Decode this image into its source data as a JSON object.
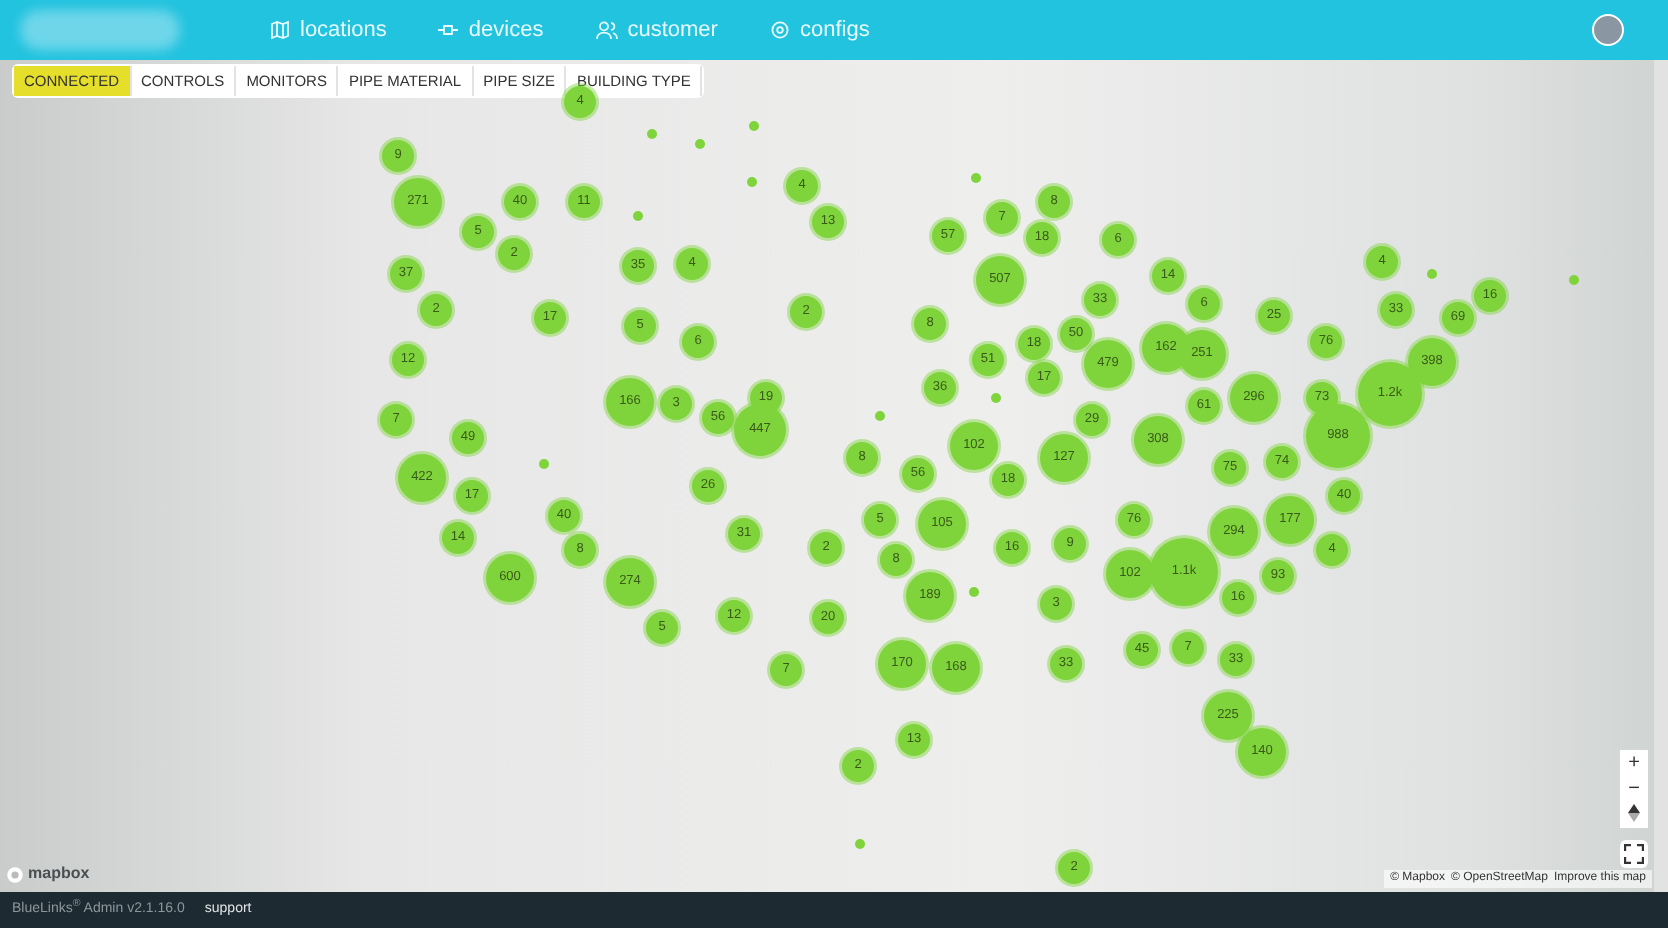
{
  "navbar": {
    "items": [
      {
        "label": "locations"
      },
      {
        "label": "devices"
      },
      {
        "label": "customer"
      },
      {
        "label": "configs"
      }
    ]
  },
  "filter_tabs": [
    {
      "label": "CONNECTED",
      "selected": true
    },
    {
      "label": "CONTROLS",
      "selected": false
    },
    {
      "label": "MONITORS",
      "selected": false
    },
    {
      "label": "PIPE MATERIAL",
      "selected": false
    },
    {
      "label": "PIPE SIZE",
      "selected": false
    },
    {
      "label": "BUILDING TYPE",
      "selected": false
    }
  ],
  "map": {
    "clusters": [
      {
        "count": "4"
      },
      {
        "count": "9"
      },
      {
        "count": "4"
      },
      {
        "count": "271"
      },
      {
        "count": "40"
      },
      {
        "count": "11"
      },
      {
        "count": "7"
      },
      {
        "count": "8"
      },
      {
        "count": "5"
      },
      {
        "count": "13"
      },
      {
        "count": "57"
      },
      {
        "count": "18"
      },
      {
        "count": "2"
      },
      {
        "count": "6"
      },
      {
        "count": "37"
      },
      {
        "count": "35"
      },
      {
        "count": "4"
      },
      {
        "count": "14"
      },
      {
        "count": "4"
      },
      {
        "count": "507"
      },
      {
        "count": "16"
      },
      {
        "count": "2"
      },
      {
        "count": "17"
      },
      {
        "count": "2"
      },
      {
        "count": "33"
      },
      {
        "count": "6"
      },
      {
        "count": "25"
      },
      {
        "count": "33"
      },
      {
        "count": "69"
      },
      {
        "count": "5"
      },
      {
        "count": "8"
      },
      {
        "count": "50"
      },
      {
        "count": "6"
      },
      {
        "count": "18"
      },
      {
        "count": "162"
      },
      {
        "count": "251"
      },
      {
        "count": "76"
      },
      {
        "count": "12"
      },
      {
        "count": "51"
      },
      {
        "count": "17"
      },
      {
        "count": "479"
      },
      {
        "count": "398"
      },
      {
        "count": "19"
      },
      {
        "count": "36"
      },
      {
        "count": "296"
      },
      {
        "count": "73"
      },
      {
        "count": "1.2k"
      },
      {
        "count": "166"
      },
      {
        "count": "3"
      },
      {
        "count": "56"
      },
      {
        "count": "61"
      },
      {
        "count": "7"
      },
      {
        "count": "49"
      },
      {
        "count": "447"
      },
      {
        "count": "29"
      },
      {
        "count": "988"
      },
      {
        "count": "8"
      },
      {
        "count": "102"
      },
      {
        "count": "127"
      },
      {
        "count": "308"
      },
      {
        "count": "422"
      },
      {
        "count": "56"
      },
      {
        "count": "75"
      },
      {
        "count": "74"
      },
      {
        "count": "17"
      },
      {
        "count": "26"
      },
      {
        "count": "18"
      },
      {
        "count": "40"
      },
      {
        "count": "40"
      },
      {
        "count": "14"
      },
      {
        "count": "31"
      },
      {
        "count": "5"
      },
      {
        "count": "105"
      },
      {
        "count": "76"
      },
      {
        "count": "294"
      },
      {
        "count": "177"
      },
      {
        "count": "8"
      },
      {
        "count": "2"
      },
      {
        "count": "16"
      },
      {
        "count": "9"
      },
      {
        "count": "4"
      },
      {
        "count": "600"
      },
      {
        "count": "8"
      },
      {
        "count": "102"
      },
      {
        "count": "1.1k"
      },
      {
        "count": "93"
      },
      {
        "count": "274"
      },
      {
        "count": "189"
      },
      {
        "count": "16"
      },
      {
        "count": "12"
      },
      {
        "count": "20"
      },
      {
        "count": "3"
      },
      {
        "count": "5"
      },
      {
        "count": "45"
      },
      {
        "count": "7"
      },
      {
        "count": "7"
      },
      {
        "count": "170"
      },
      {
        "count": "168"
      },
      {
        "count": "33"
      },
      {
        "count": "33"
      },
      {
        "count": "225"
      },
      {
        "count": "13"
      },
      {
        "count": "140"
      },
      {
        "count": "2"
      },
      {
        "count": "2"
      }
    ],
    "controls": [
      "+",
      "−"
    ],
    "logo": "mapbox",
    "attribution": [
      "© Mapbox",
      "© OpenStreetMap",
      "Improve this map"
    ]
  },
  "footer": {
    "version": "BlueLinks$^{®}$ Admin v2.1.16.0",
    "link": "support"
  }
}
